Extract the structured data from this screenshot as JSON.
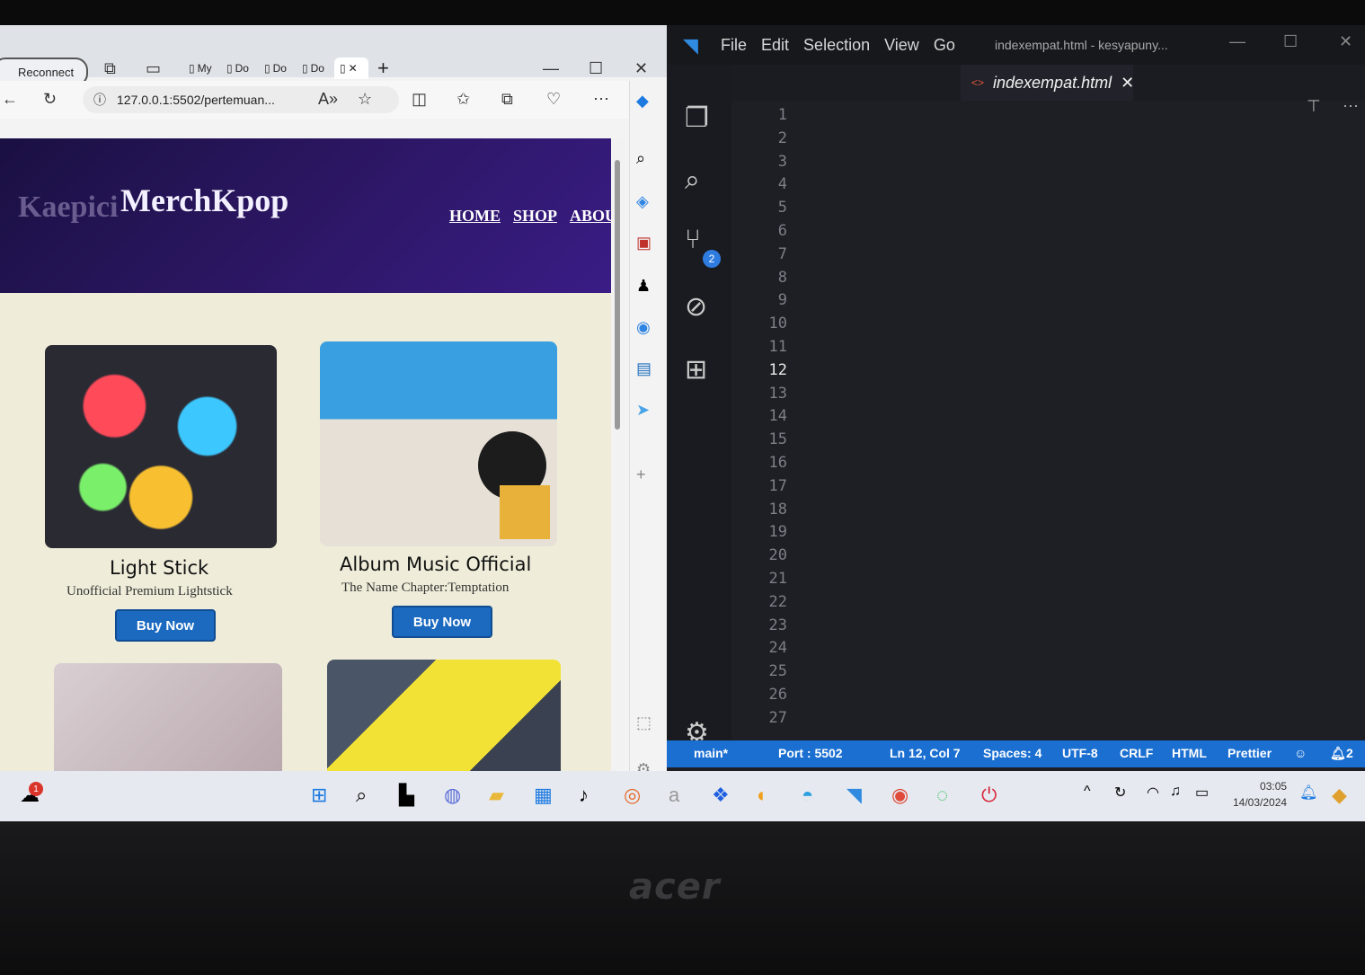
{
  "browser": {
    "reconnect_label": "Reconnect",
    "tabs": [
      "My",
      "Do",
      "Do",
      "Do"
    ],
    "url": "127.0.0.1:5502/pertemuan..."
  },
  "site": {
    "logo_shadow": "Kaepici",
    "logo": "MerchKpop",
    "nav": [
      "HOME",
      "SHOP",
      "ABOU"
    ],
    "products": [
      {
        "title": "Light Stick",
        "subtitle": "Unofficial Premium Lightstick",
        "button": "Buy Now"
      },
      {
        "title": "Album Music Official",
        "subtitle": "The Name Chapter:Temptation",
        "button": "Buy Now"
      }
    ]
  },
  "vscode": {
    "menu": [
      "File",
      "Edit",
      "Selection",
      "View",
      "Go"
    ],
    "window_title": "indexempat.html - kesyapuny...",
    "active_tab": "indexempat.html",
    "line_numbers": [
      "1",
      "2",
      "3",
      "4",
      "5",
      "6",
      "7",
      "8",
      "9",
      "10",
      "11",
      "12",
      "13",
      "14",
      "15",
      "16",
      "17",
      "18",
      "19",
      "20",
      "21",
      "22",
      "23",
      "24",
      "25",
      "26",
      "27"
    ],
    "current_line": "12",
    "scm_badge": "2",
    "status": {
      "branch": "main*",
      "port": "Port : 5502",
      "position": "Ln 12, Col 7",
      "spaces": "Spaces: 4",
      "encoding": "UTF-8",
      "eol": "CRLF",
      "language": "HTML",
      "formatter": "Prettier",
      "notifications": "2"
    }
  },
  "taskbar": {
    "notification_count": "1",
    "time": "03:05",
    "date": "14/03/2024"
  },
  "laptop_brand": "acer"
}
